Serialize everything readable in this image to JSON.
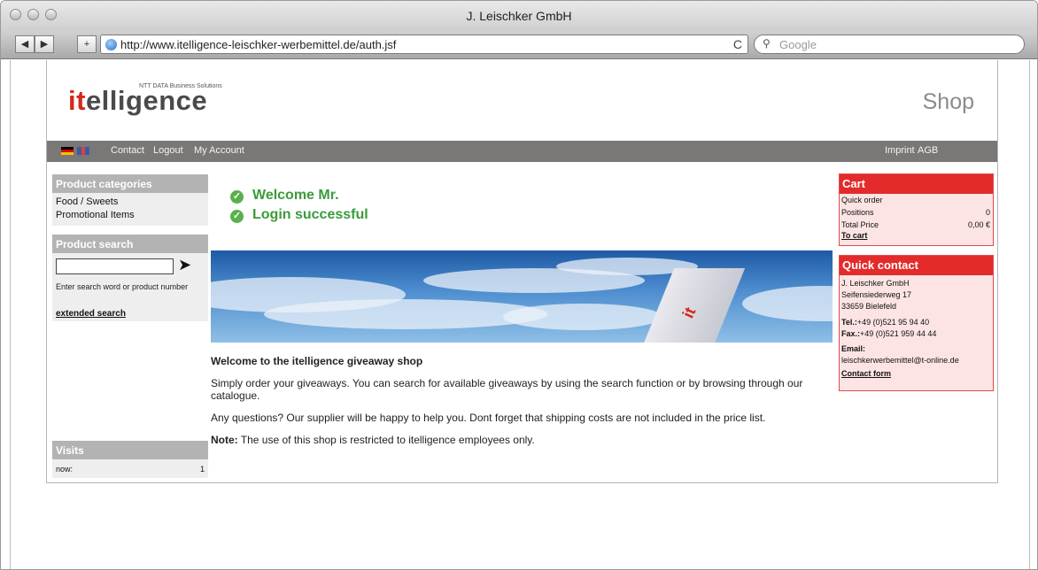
{
  "browser": {
    "window_title": "J. Leischker GmbH",
    "url": "http://www.itelligence-leischker-werbemittel.de/auth.jsf",
    "search_placeholder": "Google",
    "back": "◀",
    "forward": "▶",
    "add": "+",
    "reload": "C"
  },
  "header": {
    "logo_it": "it",
    "logo_rest": "elligence",
    "logo_sub": "NTT DATA Business Solutions",
    "shop_label": "Shop"
  },
  "nav": {
    "links": [
      "Contact",
      "Logout",
      "My Account"
    ],
    "right_links": [
      "Imprint",
      "AGB"
    ]
  },
  "sidebar": {
    "categories_title": "Product categories",
    "categories": [
      "Food / Sweets",
      "Promotional Items"
    ],
    "search_title": "Product search",
    "search_hint": "Enter search word or product number",
    "extended_search": "extended search",
    "visits_title": "Visits",
    "visits_label": "now:",
    "visits_count": "1"
  },
  "main": {
    "welcome": "Welcome Mr.",
    "login": "Login successful",
    "shop_title": "Welcome to the itelligence giveaway shop",
    "p1": "Simply order your giveaways. You can search for available giveaways by using the search function or by browsing through our catalogue.",
    "p2": "Any questions? Our supplier will be happy to help you. Dont forget that shipping costs are not included in the price list.",
    "note_label": "Note:",
    "note_text": " The use of this shop is restricted to itelligence employees only.",
    "banner_logo": "it"
  },
  "cart": {
    "title": "Cart",
    "quick_order": "Quick order",
    "positions_label": "Positions",
    "positions_value": "0",
    "total_label": "Total Price",
    "total_value": "0,00 €",
    "to_cart": "To cart"
  },
  "quick_contact": {
    "title": "Quick contact",
    "company": "J. Leischker GmbH",
    "street": "Seifensiederweg 17",
    "city": "33659 Bielefeld",
    "tel_label": "Tel.:",
    "tel": "+49 (0)521 95 94 40",
    "fax_label": "Fax.:",
    "fax": "+49 (0)521 959 44 44",
    "email_label": "Email:",
    "email": "leischkerwerbemittel@t-online.de",
    "contact_form": "Contact form"
  },
  "colors": {
    "brand_red": "#d7261c",
    "success_green": "#3a9b3a",
    "nav_gray": "#7a7877"
  }
}
